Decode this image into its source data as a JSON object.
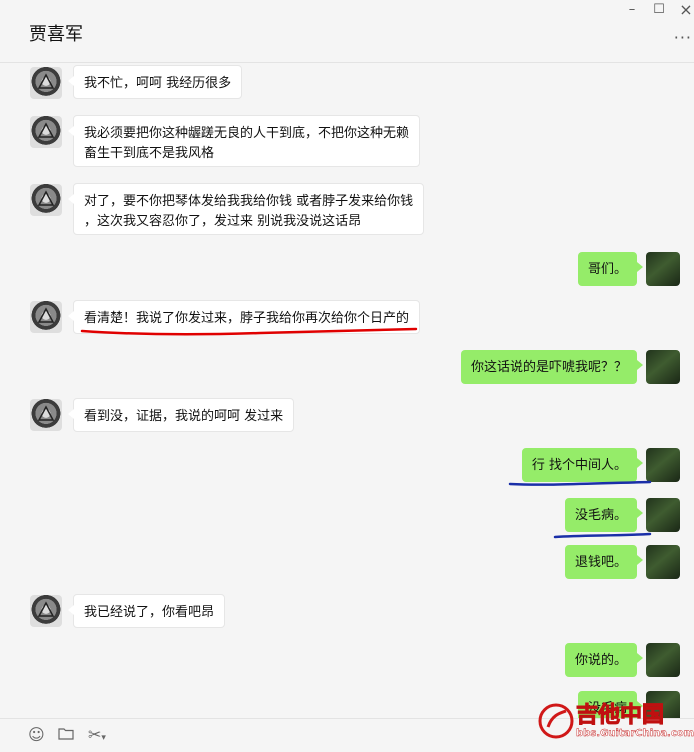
{
  "window": {
    "title": "贾喜军",
    "controls": {
      "minimize": "–",
      "maximize": "☐",
      "more": "···"
    }
  },
  "messages": [
    {
      "side": "left",
      "text": "我不忙，呵呵 我经历很多"
    },
    {
      "side": "left",
      "lines": [
        "我必须要把你这种龌蹉无良的人干到底，不把你这种无赖",
        "畜生干到底不是我风格"
      ]
    },
    {
      "side": "left",
      "lines": [
        "对了，要不你把琴体发给我我给你钱 或者脖子发来给你钱",
        "，这次我又容忍你了，发过来 别说我没说这话昂"
      ]
    },
    {
      "side": "right",
      "text": "哥们。"
    },
    {
      "side": "left",
      "text": "看清楚！我说了你发过来，脖子我给你再次给你个日产的"
    },
    {
      "side": "right",
      "text": "你这话说的是吓唬我呢？？"
    },
    {
      "side": "left",
      "text": "看到没，证据，我说的呵呵 发过来"
    },
    {
      "side": "right",
      "text": "行 找个中间人。"
    },
    {
      "side": "right",
      "text": "没毛病。"
    },
    {
      "side": "right",
      "text": "退钱吧。"
    },
    {
      "side": "left",
      "text": "我已经说了，你看吧昂"
    },
    {
      "side": "right",
      "text": "你说的。"
    },
    {
      "side": "right",
      "text": "没毛病"
    }
  ],
  "toolbar": {
    "emoji_icon": "smile-icon",
    "folder_icon": "folder-icon",
    "scissors_icon": "scissors-icon"
  },
  "watermark": {
    "name": "吉他中国",
    "url": "bbs.GuitarChina.com"
  },
  "colors": {
    "self_bubble": "#95ec69",
    "other_bubble": "#ffffff",
    "background": "#f5f5f5",
    "red_underline": "#e00000",
    "blue_underline": "#1a2fa8"
  }
}
